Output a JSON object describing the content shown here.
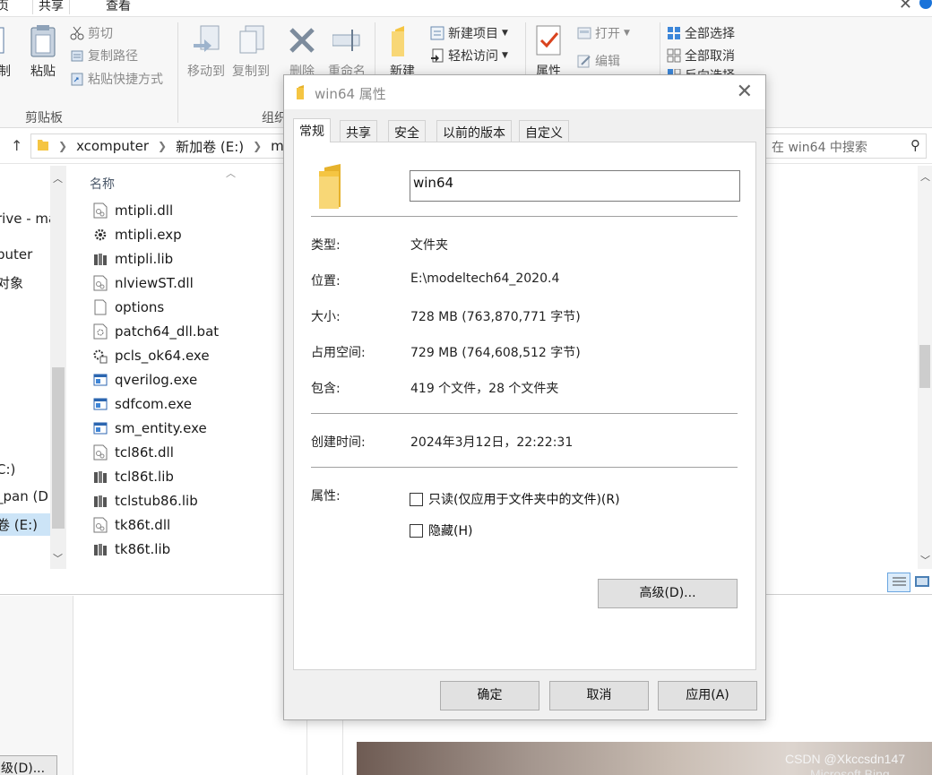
{
  "explorer": {
    "tabs": [
      "页",
      "共享",
      "查看"
    ],
    "ribbon": {
      "clipboard": {
        "cut_tail": "制",
        "paste": "粘贴",
        "cut": "剪切",
        "copy_path": "复制路径",
        "paste_shortcut": "粘贴快捷方式",
        "group_label": "剪贴板"
      },
      "organize": {
        "move_to": "移动到",
        "copy_to": "复制到",
        "delete": "删除",
        "rename": "重命名",
        "group_label": "组织"
      },
      "new": {
        "new_folder": "新建",
        "new_item": "新建项目",
        "easy_access": "轻松访问"
      },
      "open": {
        "properties": "属性",
        "open": "打开",
        "edit": "编辑"
      },
      "select": {
        "select_all": "全部选择",
        "select_none": "全部取消",
        "invert": "反向选择"
      }
    },
    "address": {
      "crumbs": [
        "xcomputer",
        "新加卷 (E:)",
        "moc"
      ]
    },
    "search": {
      "placeholder": "在 win64 中搜索"
    },
    "nav": {
      "items": [
        "rive - ma",
        "puter",
        "对象",
        "C:)",
        "_pan (D",
        "卷 (E:)"
      ]
    },
    "files": {
      "column_name": "名称",
      "items": [
        {
          "name": "mtipli.dll",
          "icon": "dll-icon"
        },
        {
          "name": "mtipli.exp",
          "icon": "gear-file-icon"
        },
        {
          "name": "mtipli.lib",
          "icon": "lib-icon"
        },
        {
          "name": "nlviewST.dll",
          "icon": "dll-icon"
        },
        {
          "name": "options",
          "icon": "blank-file-icon"
        },
        {
          "name": "patch64_dll.bat",
          "icon": "bat-icon"
        },
        {
          "name": "pcls_ok64.exe",
          "icon": "exe-gear-icon"
        },
        {
          "name": "qverilog.exe",
          "icon": "exe-icon"
        },
        {
          "name": "sdfcom.exe",
          "icon": "exe-icon"
        },
        {
          "name": "sm_entity.exe",
          "icon": "exe-icon"
        },
        {
          "name": "tcl86t.dll",
          "icon": "dll-icon"
        },
        {
          "name": "tcl86t.lib",
          "icon": "lib-icon"
        },
        {
          "name": "tclstub86.lib",
          "icon": "lib-icon"
        },
        {
          "name": "tk86t.dll",
          "icon": "dll-icon"
        },
        {
          "name": "tk86t.lib",
          "icon": "lib-icon"
        }
      ]
    },
    "lower_button": "级(D)..."
  },
  "dialog": {
    "title": "win64 属性",
    "tabs": [
      "常规",
      "共享",
      "安全",
      "以前的版本",
      "自定义"
    ],
    "active_tab": "常规",
    "name_value": "win64",
    "props": {
      "type_label": "类型:",
      "type_value": "文件夹",
      "location_label": "位置:",
      "location_value": "E:\\modeltech64_2020.4",
      "size_label": "大小:",
      "size_value": "728 MB (763,870,771 字节)",
      "disk_label": "占用空间:",
      "disk_value": "729 MB (764,608,512 字节)",
      "contains_label": "包含:",
      "contains_value": "419 个文件，28 个文件夹",
      "created_label": "创建时间:",
      "created_value": "2024年3月12日，22:22:31",
      "attr_label": "属性:",
      "readonly_label": "只读(仅应用于文件夹中的文件)(R)",
      "readonly_checked": false,
      "hidden_label": "隐藏(H)",
      "hidden_checked": false,
      "advanced_button": "高级(D)..."
    },
    "buttons": {
      "ok": "确定",
      "cancel": "取消",
      "apply": "应用(A)"
    }
  },
  "watermark": {
    "line1": "CSDN @Xkccsdn147",
    "line2": "Microsoft Bing"
  },
  "colors": {
    "folder": "#f5c542",
    "selection": "#cce4f7",
    "accent": "#1a73d9"
  }
}
